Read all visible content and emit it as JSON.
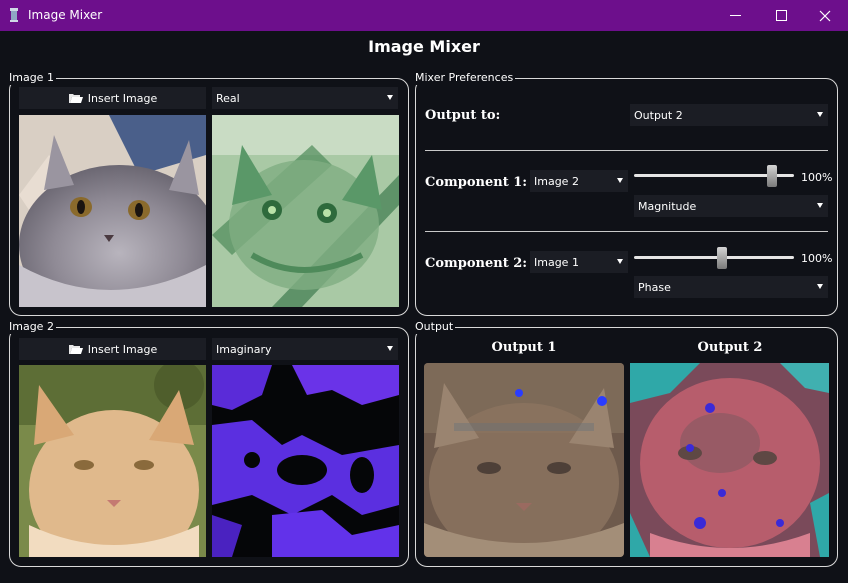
{
  "window": {
    "title": "Image Mixer",
    "heading": "Image Mixer"
  },
  "image1": {
    "group_title": "Image 1",
    "insert_label": "Insert Image",
    "component_select": "Real"
  },
  "image2": {
    "group_title": "Image 2",
    "insert_label": "Insert Image",
    "component_select": "Imaginary"
  },
  "mixer": {
    "group_title": "Mixer Preferences",
    "output_to_label": "Output to:",
    "output_to_value": "Output 2",
    "component1": {
      "label": "Component 1:",
      "image": "Image 2",
      "slider_percent": 100,
      "slider_text": "100%",
      "mode": "Magnitude"
    },
    "component2": {
      "label": "Component 2:",
      "image": "Image 1",
      "slider_percent": 100,
      "slider_text": "100%",
      "mode": "Phase"
    }
  },
  "output": {
    "group_title": "Output",
    "output1_label": "Output 1",
    "output2_label": "Output 2"
  },
  "icons": {
    "app": "cup-icon",
    "insert": "folder-open-icon",
    "minimize": "minimize-icon",
    "maximize": "maximize-icon",
    "close": "close-icon"
  },
  "colors": {
    "titlebar": "#6d0f8c",
    "background": "#0f1117",
    "control": "#1b1d24",
    "border": "#d9d9d9"
  }
}
